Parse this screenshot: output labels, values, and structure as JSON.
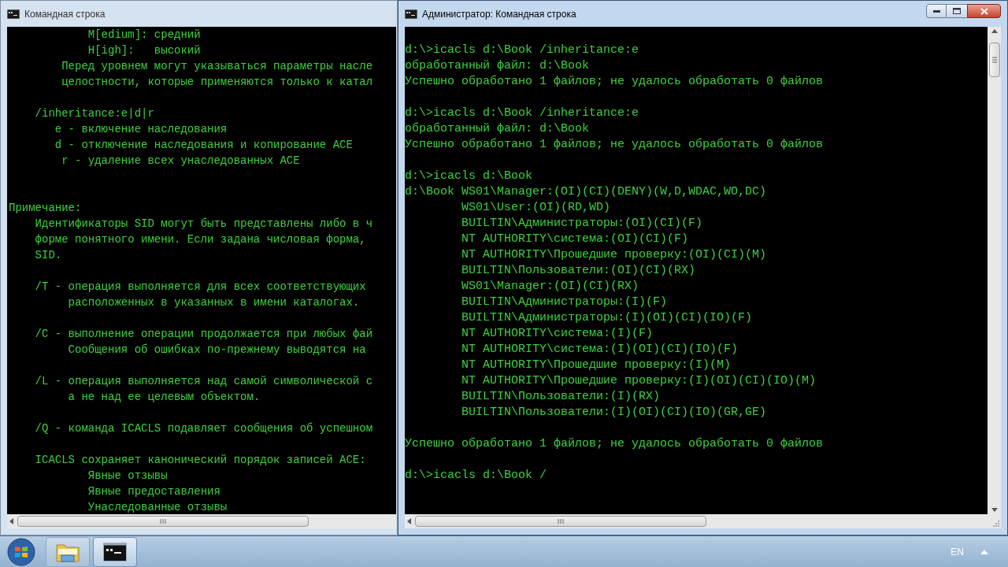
{
  "windows": [
    {
      "title": "Командная строка",
      "active": false,
      "vertical_scrollbar": false,
      "blocks": [
        {
          "kind": "text",
          "lines": [
            "            M[edium]: средний",
            "            H[igh]:   высокий",
            "        Перед уровнем могут указываться параметры насле",
            "        целостности, которые применяются только к катал"
          ]
        },
        {
          "kind": "text",
          "lines": [
            "    /inheritance:e|d|r",
            "       e - включение наследования",
            "       d - отключение наследования и копирование ACE",
            "        r - удаление всех унаследованных ACE"
          ]
        },
        {
          "kind": "section",
          "lines": [
            "Примечание:",
            "    Идентификаторы SID могут быть представлены либо в ч",
            "    форме понятного имени. Если задана числовая форма,",
            "    SID."
          ]
        },
        {
          "kind": "text",
          "lines": [
            "    /T - операция выполняется для всех соответствующих",
            "         расположенных в указанных в имени каталогах."
          ]
        },
        {
          "kind": "text",
          "lines": [
            "    /C - выполнение операции продолжается при любых фай",
            "         Сообщения об ошибках по-прежнему выводятся на"
          ]
        },
        {
          "kind": "text",
          "lines": [
            "    /L - операция выполняется над самой символической с",
            "         а не над ее целевым объектом."
          ]
        },
        {
          "kind": "text",
          "lines": [
            "    /Q - команда ICACLS подавляет сообщения об успешном"
          ]
        },
        {
          "kind": "text",
          "lines": [
            "    ICACLS сохраняет канонический порядок записей ACE:",
            "            Явные отзывы",
            "            Явные предоставления",
            "            Унаследованные отзывы"
          ]
        }
      ]
    },
    {
      "title": "Администратор: Командная строка",
      "active": true,
      "vertical_scrollbar": true,
      "blocks": [
        {
          "kind": "text",
          "lines": [
            "d:\\>icacls d:\\Book /inheritance:e",
            "обработанный файл: d:\\Book",
            "Успешно обработано 1 файлов; не удалось обработать 0 файлов"
          ]
        },
        {
          "kind": "text",
          "lines": [
            "d:\\>icacls d:\\Book /inheritance:e",
            "обработанный файл: d:\\Book",
            "Успешно обработано 1 файлов; не удалось обработать 0 файлов"
          ]
        },
        {
          "kind": "text",
          "lines": [
            "d:\\>icacls d:\\Book",
            "d:\\Book WS01\\Manager:(OI)(CI)(DENY)(W,D,WDAC,WO,DC)",
            "        WS01\\User:(OI)(RD,WD)",
            "        BUILTIN\\Администраторы:(OI)(CI)(F)",
            "        NT AUTHORITY\\система:(OI)(CI)(F)",
            "        NT AUTHORITY\\Прошедшие проверку:(OI)(CI)(M)",
            "        BUILTIN\\Пользователи:(OI)(CI)(RX)",
            "        WS01\\Manager:(OI)(CI)(RX)",
            "        BUILTIN\\Администраторы:(I)(F)",
            "        BUILTIN\\Администраторы:(I)(OI)(CI)(IO)(F)",
            "        NT AUTHORITY\\система:(I)(F)",
            "        NT AUTHORITY\\система:(I)(OI)(CI)(IO)(F)",
            "        NT AUTHORITY\\Прошедшие проверку:(I)(M)",
            "        NT AUTHORITY\\Прошедшие проверку:(I)(OI)(CI)(IO)(M)",
            "        BUILTIN\\Пользователи:(I)(RX)",
            "        BUILTIN\\Пользователи:(I)(OI)(CI)(IO)(GR,GE)"
          ]
        },
        {
          "kind": "text",
          "lines": [
            "Успешно обработано 1 файлов; не удалось обработать 0 файлов"
          ]
        },
        {
          "kind": "text",
          "lines": [
            "d:\\>icacls d:\\Book /"
          ]
        }
      ]
    }
  ],
  "taskbar": {
    "buttons": [
      {
        "kind": "explorer",
        "selected": false
      },
      {
        "kind": "console",
        "selected": true
      }
    ],
    "language": "EN"
  }
}
